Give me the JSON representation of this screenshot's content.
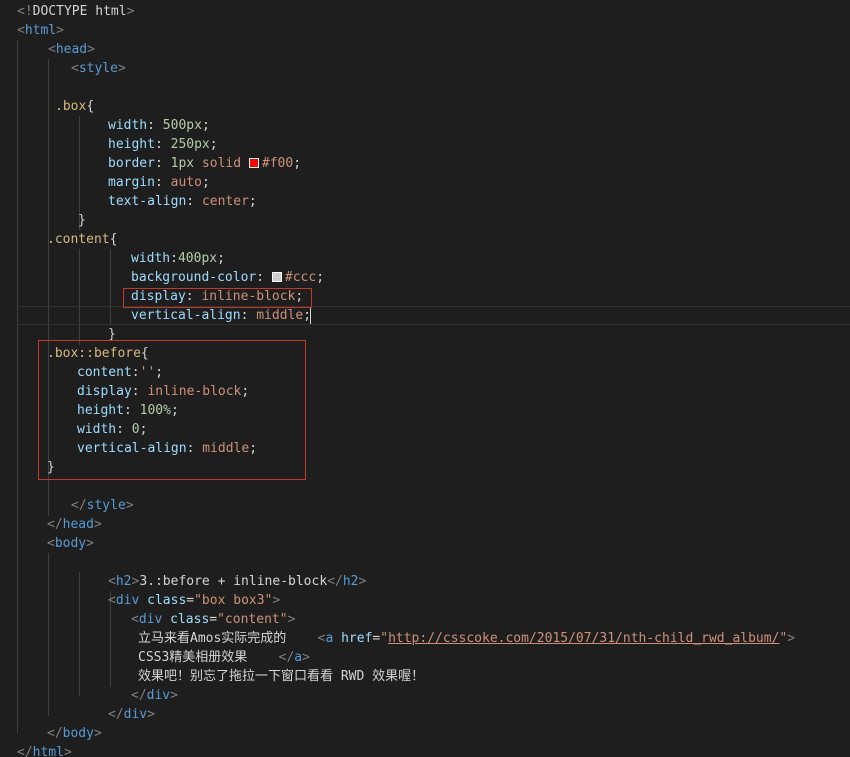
{
  "editor": {
    "theme_colors": {
      "background": "#1e1e1e",
      "tag": "#569cd6",
      "punctuation": "#808080",
      "selector": "#d7ba7d",
      "property": "#9cdcfe",
      "value": "#ce9178",
      "number": "#b5cea8",
      "text": "#d4d4d4",
      "highlight_border": "#c0392b"
    },
    "lines": [
      {
        "tokens": [
          [
            "<!",
            "p"
          ],
          [
            "DOCTYPE html",
            "t"
          ],
          [
            ">",
            "p"
          ]
        ]
      },
      {
        "tokens": [
          [
            "<",
            "p"
          ],
          [
            "html",
            "g"
          ],
          [
            ">",
            "p"
          ]
        ]
      },
      {
        "tokens": [
          [
            "<",
            "p"
          ],
          [
            "head",
            "g"
          ],
          [
            ">",
            "p"
          ]
        ]
      },
      {
        "tokens": [
          [
            "<",
            "p"
          ],
          [
            "style",
            "g"
          ],
          [
            ">",
            "p"
          ]
        ]
      },
      {
        "tokens": []
      },
      {
        "tokens": [
          [
            ".box",
            "s"
          ],
          [
            "{",
            "t"
          ]
        ]
      },
      {
        "tokens": [
          [
            "width",
            "k"
          ],
          [
            ": ",
            "t"
          ],
          [
            "500px",
            "n"
          ],
          [
            ";",
            "t"
          ]
        ]
      },
      {
        "tokens": [
          [
            "height",
            "k"
          ],
          [
            ": ",
            "t"
          ],
          [
            "250px",
            "n"
          ],
          [
            ";",
            "t"
          ]
        ]
      },
      {
        "tokens": [
          [
            "border",
            "k"
          ],
          [
            ": ",
            "t"
          ],
          [
            "1px",
            "n"
          ],
          [
            " solid ",
            "v"
          ],
          [
            "#f00",
            "v"
          ],
          [
            ";",
            "t"
          ]
        ],
        "swatch": "#ff0000"
      },
      {
        "tokens": [
          [
            "margin",
            "k"
          ],
          [
            ": ",
            "t"
          ],
          [
            "auto",
            "v"
          ],
          [
            ";",
            "t"
          ]
        ]
      },
      {
        "tokens": [
          [
            "text-align",
            "k"
          ],
          [
            ": ",
            "t"
          ],
          [
            "center",
            "v"
          ],
          [
            ";",
            "t"
          ]
        ]
      },
      {
        "tokens": [
          [
            "}",
            "t"
          ]
        ]
      },
      {
        "tokens": [
          [
            ".content",
            "s"
          ],
          [
            "{",
            "t"
          ]
        ]
      },
      {
        "tokens": [
          [
            "width",
            "k"
          ],
          [
            ":",
            "t"
          ],
          [
            "400px",
            "n"
          ],
          [
            ";",
            "t"
          ]
        ]
      },
      {
        "tokens": [
          [
            "background-color",
            "k"
          ],
          [
            ": ",
            "t"
          ],
          [
            "#ccc",
            "v"
          ],
          [
            ";",
            "t"
          ]
        ],
        "swatch": "#cccccc"
      },
      {
        "tokens": [
          [
            "display",
            "k"
          ],
          [
            ": ",
            "t"
          ],
          [
            "inline-block",
            "v"
          ],
          [
            ";",
            "t"
          ]
        ]
      },
      {
        "tokens": [
          [
            "vertical-align",
            "k"
          ],
          [
            ": ",
            "t"
          ],
          [
            "middle",
            "v"
          ],
          [
            ";",
            "t"
          ]
        ]
      },
      {
        "tokens": [
          [
            "}",
            "t"
          ]
        ]
      },
      {
        "tokens": [
          [
            ".box::before",
            "s"
          ],
          [
            "{",
            "t"
          ]
        ]
      },
      {
        "tokens": [
          [
            "content",
            "k"
          ],
          [
            ":",
            "t"
          ],
          [
            "''",
            "v"
          ],
          [
            ";",
            "t"
          ]
        ]
      },
      {
        "tokens": [
          [
            "display",
            "k"
          ],
          [
            ": ",
            "t"
          ],
          [
            "inline-block",
            "v"
          ],
          [
            ";",
            "t"
          ]
        ]
      },
      {
        "tokens": [
          [
            "height",
            "k"
          ],
          [
            ": ",
            "t"
          ],
          [
            "100%",
            "n"
          ],
          [
            ";",
            "t"
          ]
        ]
      },
      {
        "tokens": [
          [
            "width",
            "k"
          ],
          [
            ": ",
            "t"
          ],
          [
            "0",
            "n"
          ],
          [
            ";",
            "t"
          ]
        ]
      },
      {
        "tokens": [
          [
            "vertical-align",
            "k"
          ],
          [
            ": ",
            "t"
          ],
          [
            "middle",
            "v"
          ],
          [
            ";",
            "t"
          ]
        ]
      },
      {
        "tokens": [
          [
            "}",
            "t"
          ]
        ]
      },
      {
        "tokens": []
      },
      {
        "tokens": [
          [
            "</",
            "p"
          ],
          [
            "style",
            "g"
          ],
          [
            ">",
            "p"
          ]
        ]
      },
      {
        "tokens": [
          [
            "</",
            "p"
          ],
          [
            "head",
            "g"
          ],
          [
            ">",
            "p"
          ]
        ]
      },
      {
        "tokens": [
          [
            "<",
            "p"
          ],
          [
            "body",
            "g"
          ],
          [
            ">",
            "p"
          ]
        ]
      },
      {
        "tokens": []
      },
      {
        "tokens": [
          [
            "<",
            "p"
          ],
          [
            "h2",
            "g"
          ],
          [
            ">",
            "p"
          ],
          [
            "3.:before + inline-block",
            "t"
          ],
          [
            "</",
            "p"
          ],
          [
            "h2",
            "g"
          ],
          [
            ">",
            "p"
          ]
        ]
      },
      {
        "tokens": [
          [
            "<",
            "p"
          ],
          [
            "div",
            "g"
          ],
          [
            " ",
            "t"
          ],
          [
            "class",
            "k"
          ],
          [
            "=",
            "t"
          ],
          [
            "\"box box3\"",
            "v"
          ],
          [
            ">",
            "p"
          ]
        ]
      },
      {
        "tokens": [
          [
            "<",
            "p"
          ],
          [
            "div",
            "g"
          ],
          [
            " ",
            "t"
          ],
          [
            "class",
            "k"
          ],
          [
            "=",
            "t"
          ],
          [
            "\"content\"",
            "v"
          ],
          [
            ">",
            "p"
          ]
        ]
      },
      {
        "tokens": [
          [
            "立马来看Amos实际完成的    ",
            "t"
          ],
          [
            "<",
            "p"
          ],
          [
            "a",
            "g"
          ],
          [
            " ",
            "t"
          ],
          [
            "href",
            "k"
          ],
          [
            "=",
            "t"
          ],
          [
            "\"",
            "v"
          ],
          [
            "http://csscoke.com/2015/07/31/nth-child_rwd_album/",
            "u"
          ],
          [
            "\"",
            "v"
          ],
          [
            ">",
            "p"
          ]
        ]
      },
      {
        "tokens": [
          [
            "CSS3精美相册效果    ",
            "t"
          ],
          [
            "</",
            "p"
          ],
          [
            "a",
            "g"
          ],
          [
            ">",
            "p"
          ]
        ]
      },
      {
        "tokens": [
          [
            "效果吧！别忘了拖拉一下窗口看看 RWD 效果喔！",
            "t"
          ]
        ]
      },
      {
        "tokens": [
          [
            "</",
            "p"
          ],
          [
            "div",
            "g"
          ],
          [
            ">",
            "p"
          ]
        ]
      },
      {
        "tokens": [
          [
            "</",
            "p"
          ],
          [
            "div",
            "g"
          ],
          [
            ">",
            "p"
          ]
        ]
      },
      {
        "tokens": [
          [
            "</",
            "p"
          ],
          [
            "body",
            "g"
          ],
          [
            ">",
            "p"
          ]
        ]
      },
      {
        "tokens": [
          [
            "</",
            "p"
          ],
          [
            "html",
            "g"
          ],
          [
            ">",
            "p"
          ]
        ]
      }
    ]
  }
}
